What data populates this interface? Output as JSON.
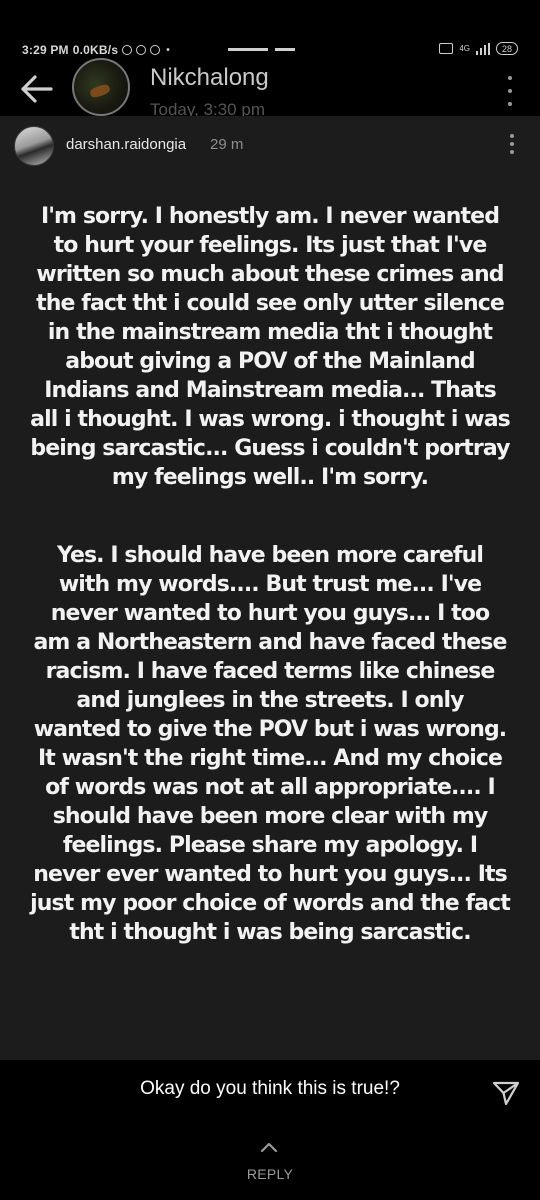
{
  "status_bar": {
    "time": "3:29 PM",
    "speed": "0.0KB/s",
    "network_label": "4G",
    "battery": "28"
  },
  "header": {
    "name": "Nikchalong",
    "time": "Today, 3:30 pm"
  },
  "post": {
    "username": "darshan.raidongia",
    "age": "29 m",
    "paragraphs": [
      "I'm sorry. I honestly am. I never wanted to hurt your feelings. Its just that I've written so much about these crimes and the fact tht i could see only utter silence in the mainstream media tht i thought about giving a POV of the Mainland Indians and Mainstream media... Thats all i thought. I was wrong. i thought i was being sarcastic... Guess i couldn't portray my feelings well.. I'm sorry.",
      "Yes. I should have been more careful with my words.... But trust me... I've never wanted to hurt you guys... I too am a Northeastern and have faced these racism. I have faced terms like chinese and junglees in the streets. I only wanted to give the POV but i was wrong. It wasn't the right time... And my choice of words was not at all appropriate.... I should have been more clear with my feelings. Please share my apology. I never ever wanted to hurt you guys... Its just my poor choice of words and the fact tht i thought i was being sarcastic."
    ]
  },
  "reply": {
    "question": "Okay do you think this is true!?",
    "label": "REPLY"
  },
  "colors": {
    "background": "#000000",
    "card": "#1c1c1c",
    "text": "#f2f2f2",
    "muted": "#8e8e8e"
  },
  "icons": [
    "back-arrow-icon",
    "more-vertical-icon",
    "send-icon",
    "chevron-up-icon"
  ]
}
